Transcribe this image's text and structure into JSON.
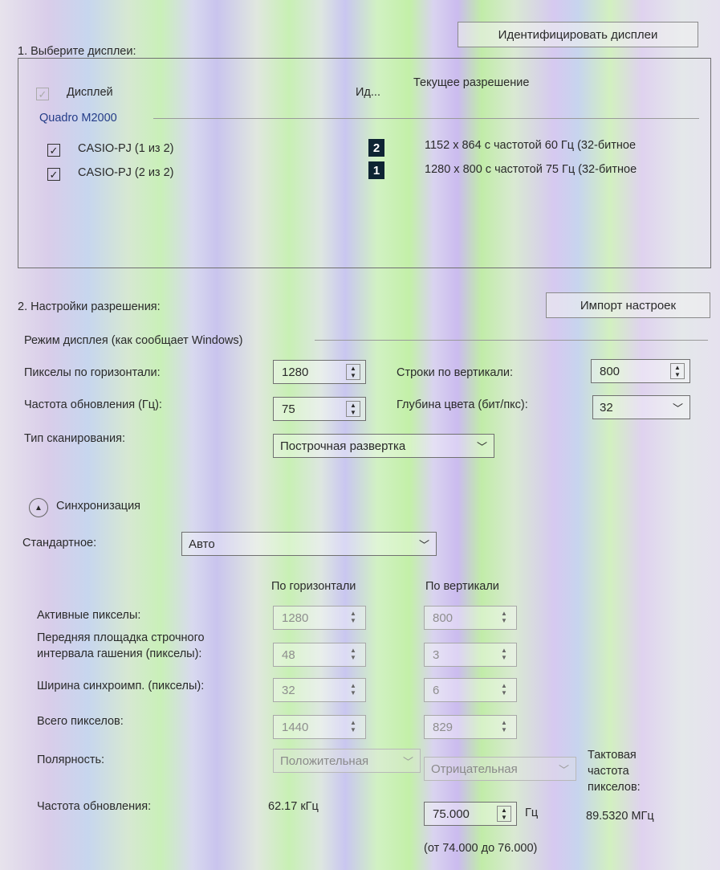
{
  "section1": {
    "title": "1. Выберите дисплеи:",
    "identify_button": "Идентифицировать дисплеи",
    "columns": {
      "display": "Дисплей",
      "id": "Ид...",
      "resolution": "Текущее разрешение"
    },
    "gpu_name": "Quadro M2000",
    "displays": [
      {
        "name": "CASIO-PJ (1 из 2)",
        "id": "2",
        "resolution": "1152 x 864 с частотой 60 Гц (32-битное",
        "checked": true
      },
      {
        "name": "CASIO-PJ (2 из 2)",
        "id": "1",
        "resolution": "1280 x 800 с частотой 75 Гц (32-битное",
        "checked": true
      }
    ]
  },
  "section2": {
    "title": "2. Настройки разрешения:",
    "import_button": "Импорт настроек",
    "mode_label": "Режим дисплея (как сообщает Windows)",
    "h_pixels_label": "Пикселы по горизонтали:",
    "h_pixels_value": "1280",
    "v_lines_label": "Строки по вертикали:",
    "v_lines_value": "800",
    "refresh_label": "Частота обновления (Гц):",
    "refresh_value": "75",
    "color_depth_label": "Глубина цвета (бит/пкс):",
    "color_depth_value": "32",
    "scan_type_label": "Тип сканирования:",
    "scan_type_value": "Построчная развертка"
  },
  "timing": {
    "section_label": "Синхронизация",
    "standard_label": "Стандартное:",
    "standard_value": "Авто",
    "col_horizontal": "По горизонтали",
    "col_vertical": "По вертикали",
    "active_label": "Активные пикселы:",
    "active_h": "1280",
    "active_v": "800",
    "front_porch_label_1": "Передняя площадка строчного",
    "front_porch_label_2": "интервала гашения (пикселы):",
    "front_porch_h": "48",
    "front_porch_v": "3",
    "sync_width_label": "Ширина синхроимп. (пикселы):",
    "sync_width_h": "32",
    "sync_width_v": "6",
    "total_label": "Всего пикселов:",
    "total_h": "1440",
    "total_v": "829",
    "polarity_label": "Полярность:",
    "polarity_h": "Положительная",
    "polarity_v": "Отрицательная",
    "refresh_label": "Частота обновления:",
    "refresh_h": "62.17 кГц",
    "refresh_v": "75.000",
    "refresh_v_unit": "Гц",
    "refresh_range": "(от 74.000 до 76.000)",
    "pixel_clock_label_1": "Тактовая",
    "pixel_clock_label_2": "частота",
    "pixel_clock_label_3": "пикселов:",
    "pixel_clock_value": "89.5320 МГц"
  }
}
